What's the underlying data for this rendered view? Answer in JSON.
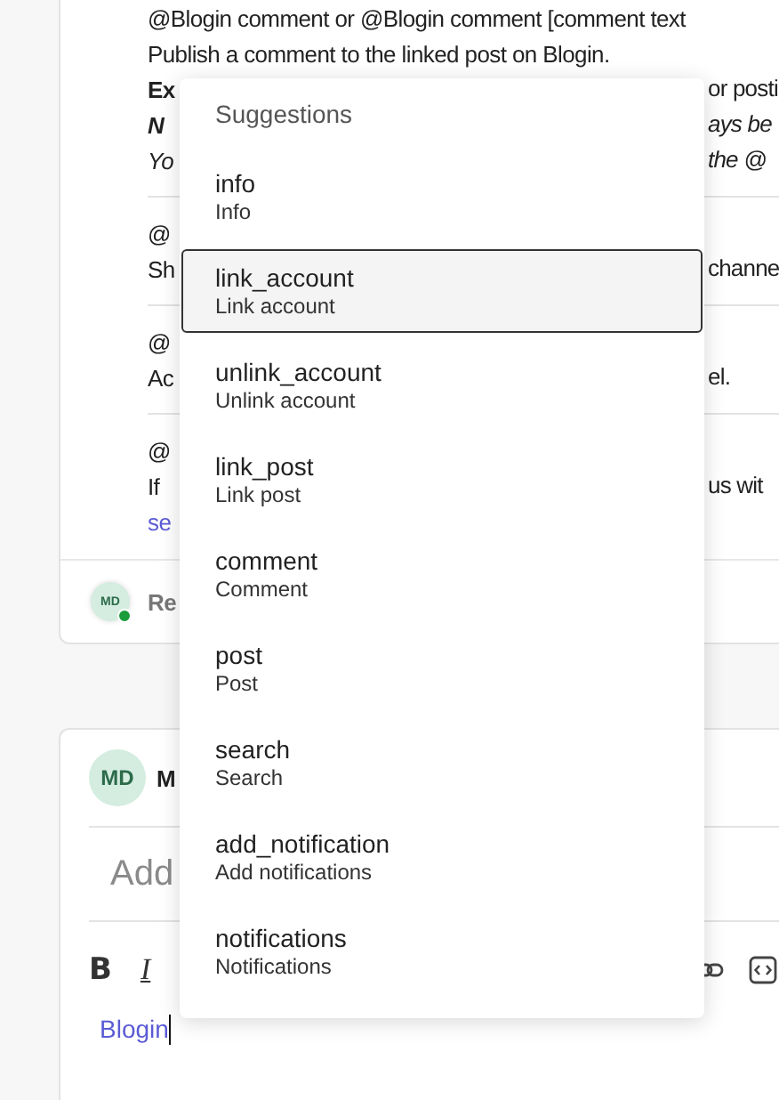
{
  "help_entries": [
    {
      "lines": [
        {
          "kind": "plain",
          "left": "@Blogin comment or @Blogin comment [comment text"
        },
        {
          "kind": "plain",
          "left": "Publish a comment to the linked post on Blogin."
        },
        {
          "kind": "example",
          "left": "Ex",
          "right": "or posti"
        },
        {
          "kind": "note",
          "left": "N",
          "right": "ays be"
        },
        {
          "kind": "italic",
          "left": "Yo",
          "right": "the @"
        }
      ]
    },
    {
      "lines": [
        {
          "kind": "plain",
          "left": "@"
        },
        {
          "kind": "plain",
          "left": "Sh",
          "right": "channe"
        }
      ]
    },
    {
      "lines": [
        {
          "kind": "plain",
          "left": "@"
        },
        {
          "kind": "plain",
          "left": "Ac",
          "right": "el."
        }
      ]
    },
    {
      "lines": [
        {
          "kind": "plain",
          "left": "@"
        },
        {
          "kind": "plain",
          "left": "If",
          "right": "us wit"
        },
        {
          "kind": "link",
          "left": "se"
        }
      ]
    }
  ],
  "reply": {
    "avatar": "MD",
    "online": true,
    "prompt": "Re"
  },
  "composer": {
    "avatar": "MD",
    "author": "M",
    "title_placeholder": "Add",
    "toolbar": [
      {
        "kind": "bold",
        "label": "B"
      },
      {
        "kind": "italic",
        "label": "I"
      },
      {
        "kind": "link"
      },
      {
        "kind": "code"
      }
    ],
    "value": "Blogin"
  },
  "suggestions": {
    "title": "Suggestions",
    "items": [
      {
        "command": "info",
        "description": "Info",
        "selected": false
      },
      {
        "command": "link_account",
        "description": "Link account",
        "selected": true
      },
      {
        "command": "unlink_account",
        "description": "Unlink account",
        "selected": false
      },
      {
        "command": "link_post",
        "description": "Link post",
        "selected": false
      },
      {
        "command": "comment",
        "description": "Comment",
        "selected": false
      },
      {
        "command": "post",
        "description": "Post",
        "selected": false
      },
      {
        "command": "search",
        "description": "Search",
        "selected": false
      },
      {
        "command": "add_notification",
        "description": "Add notifications",
        "selected": false
      },
      {
        "command": "notifications",
        "description": "Notifications",
        "selected": false
      }
    ]
  }
}
